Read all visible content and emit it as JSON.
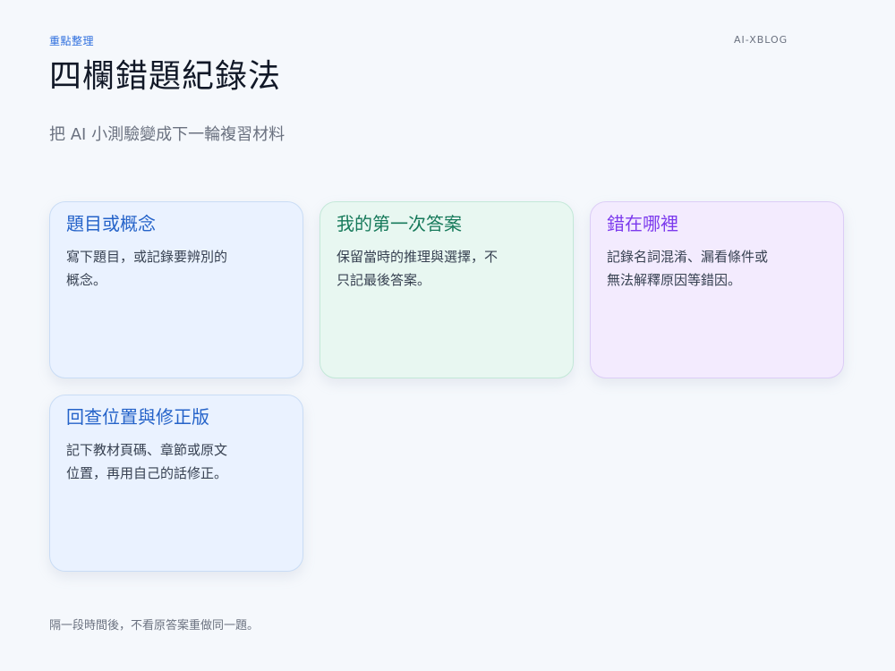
{
  "header": {
    "eyebrow": "重點整理",
    "brand": "AI-XBLOG",
    "title": "四欄錯題紀錄法",
    "subtitle": "把 AI 小測驗變成下一輪複習材料"
  },
  "cards": [
    {
      "title": "題目或概念",
      "body": "寫下題目，或記錄要辨別的概念。",
      "accent": "#2563c9",
      "background": "#eaf2ff"
    },
    {
      "title": "我的第一次答案",
      "body": "保留當時的推理與選擇，不只記最後答案。",
      "accent": "#177a5b",
      "background": "#e8f7f1"
    },
    {
      "title": "錯在哪裡",
      "body": "記錄名詞混淆、漏看條件或無法解釋原因等錯因。",
      "accent": "#7c3aed",
      "background": "#f3ebfe"
    },
    {
      "title": "回查位置與修正版",
      "body": "記下教材頁碼、章節或原文位置，再用自己的話修正。",
      "accent": "#2563c9",
      "background": "#eaf2ff"
    }
  ],
  "footer": {
    "note": "隔一段時間後，不看原答案重做同一題。"
  }
}
